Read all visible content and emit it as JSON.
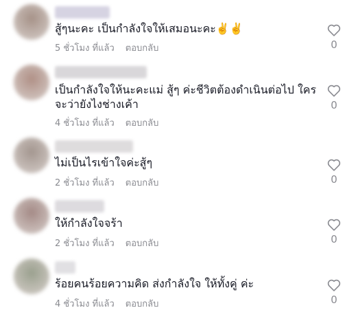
{
  "comments": [
    {
      "text": "สู้ๆนะคะ เป็นกำลังใจให้เสมอนะคะ✌️✌️",
      "time": "5 ชั่วโมง ที่แล้ว",
      "reply_label": "ตอบกลับ",
      "likes": "0",
      "avatar_color": "#a69288",
      "username_color": "#d6d3e2"
    },
    {
      "text": "เป็นกำลังใจให้นะคะแม่ สู้ๆ ค่ะชีวิตต้องดำเนินต่อไป ใครจะว่ายังไงช่างเค้า",
      "time": "4 ชั่วโมง ที่แล้ว",
      "reply_label": "ตอบกลับ",
      "likes": "0",
      "avatar_color": "#b09086",
      "username_color": "#d9d7da"
    },
    {
      "text": "ไม่เป็นไรเข้าใจค่ะสู้ๆ",
      "time": "2 ชั่วโมง ที่แล้ว",
      "reply_label": "ตอบกลับ",
      "likes": "0",
      "avatar_color": "#a3968f",
      "username_color": "#dedcdd"
    },
    {
      "text": "ให้กำลังใจจร้า",
      "time": "2 ชั่วโมง ที่แล้ว",
      "reply_label": "ตอบกลับ",
      "likes": "0",
      "avatar_color": "#a48a86",
      "username_color": "#dddbdf"
    },
    {
      "text": "ร้อยคนร้อยความคิด ส่งกำลังใจ ให้ทั้งคู่ ค่ะ",
      "time": "4 ชั่วโมง ที่แล้ว",
      "reply_label": "ตอบกลับ",
      "likes": "0",
      "avatar_color": "#9aa08e",
      "username_color": "#e1e0e3"
    }
  ],
  "icons": {
    "avatar": "avatar",
    "like": "heart-outline-icon"
  }
}
